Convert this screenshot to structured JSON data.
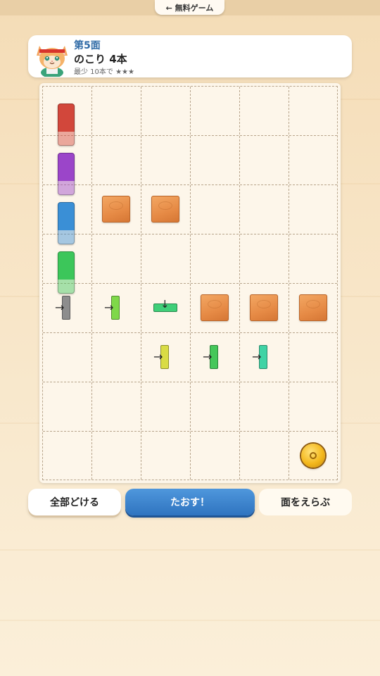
{
  "topbar": {
    "back_label": "← 無料ゲーム"
  },
  "header": {
    "level_title": "第5面",
    "remaining": "のこり 4本",
    "best": "最少 10本で ★★★"
  },
  "board": {
    "columns": 6,
    "rows": 8,
    "tall_dominoes": [
      {
        "color": "#d2473b",
        "name": "red"
      },
      {
        "color": "#9b45c9",
        "name": "purple"
      },
      {
        "color": "#3a8fd6",
        "name": "blue"
      },
      {
        "color": "#3cc65a",
        "name": "green"
      }
    ],
    "small_colors": {
      "gray": "#8d8d8d",
      "lime": "#7fd84a",
      "teal": "#3fcf78",
      "yellow": "#d9dc45",
      "green": "#45c75a",
      "mint": "#3fd3a5"
    }
  },
  "buttons": {
    "reset_label": "全部どける",
    "topple_label": "たおす！",
    "select_label": "面をえらぶ"
  }
}
